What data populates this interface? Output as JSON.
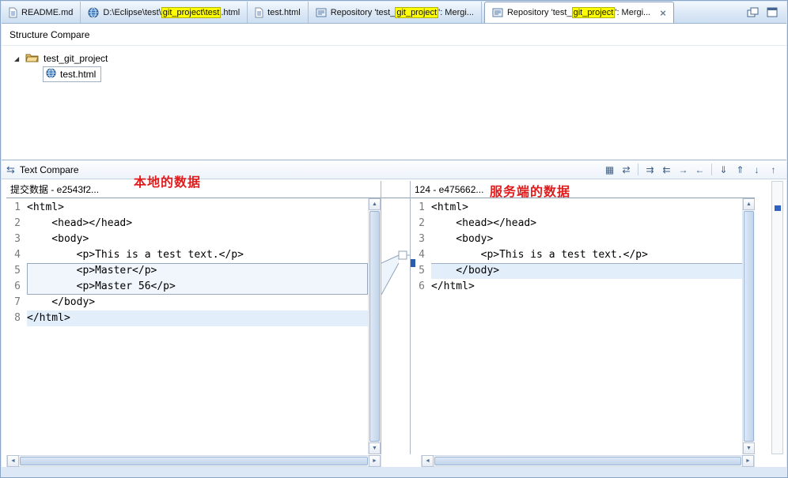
{
  "tabs": [
    {
      "label": "README.md"
    },
    {
      "pre": "D:\\Eclipse\\test\\",
      "hl": "git_project\\test",
      "post": ".html"
    },
    {
      "label": "test.html"
    },
    {
      "pre": "Repository 'test_",
      "hl": "git_project",
      "post": "': Mergi..."
    },
    {
      "pre": "Repository 'test_",
      "hl": "git_project",
      "post": "': Mergi..."
    }
  ],
  "structure_compare": {
    "title": "Structure Compare",
    "root_item": "test_git_project",
    "child_item": "test.html"
  },
  "text_compare": {
    "title": "Text Compare",
    "annotation_local": "本地的数据",
    "annotation_server": "服务端的数据",
    "left": {
      "header": "提交数据 - e2543f2...",
      "lines": [
        {
          "n": "1",
          "text": "<html>"
        },
        {
          "n": "2",
          "text": "    <head></head>"
        },
        {
          "n": "3",
          "text": "    <body>"
        },
        {
          "n": "4",
          "text": "        <p>This is a test text.</p>"
        },
        {
          "n": "5",
          "text": "        <p>Master</p>"
        },
        {
          "n": "6",
          "text": "        <p>Master 56</p>"
        },
        {
          "n": "7",
          "text": "    </body>"
        },
        {
          "n": "8",
          "text": "</html>"
        }
      ]
    },
    "right": {
      "header": "124 - e475662...",
      "lines": [
        {
          "n": "1",
          "text": "<html>"
        },
        {
          "n": "2",
          "text": "    <head></head>"
        },
        {
          "n": "3",
          "text": "    <body>"
        },
        {
          "n": "4",
          "text": "        <p>This is a test text.</p>"
        },
        {
          "n": "5",
          "text": "    </body>"
        },
        {
          "n": "6",
          "text": "</html>"
        }
      ]
    }
  },
  "glyphs": {
    "expander": "◢",
    "close": "×",
    "compare": "⇆",
    "up": "▲",
    "down": "▼",
    "left": "◄",
    "right": "►",
    "toolbar": [
      "▦",
      "⇄",
      "⇉",
      "⇇",
      "→",
      "←",
      "⇓",
      "⇑",
      "↓",
      "↑"
    ]
  },
  "colors": {
    "tab_highlight": "#ffff00",
    "annotation_red": "#e01b1b",
    "diff_fill": "#f1f6fc",
    "current_line": "#e3eefb"
  }
}
